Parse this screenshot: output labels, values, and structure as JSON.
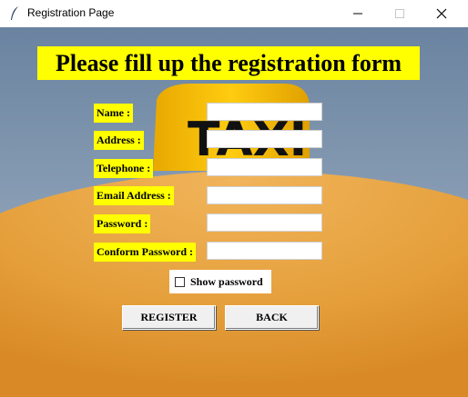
{
  "window": {
    "title": "Registration Page",
    "icon": "feather-icon",
    "controls": [
      "minimize-icon",
      "maximize-icon",
      "close-icon"
    ]
  },
  "heading": "Please fill up the registration form",
  "background": {
    "sign_text": "TAXI"
  },
  "form": {
    "fields": [
      {
        "label": "Name :",
        "value": ""
      },
      {
        "label": "Address :",
        "value": ""
      },
      {
        "label": "Telephone :",
        "value": ""
      },
      {
        "label": "Email Address :",
        "value": ""
      },
      {
        "label": "Password :",
        "value": ""
      },
      {
        "label": "Conform Password :",
        "value": ""
      }
    ],
    "show_password": {
      "label": "Show password",
      "checked": false
    }
  },
  "buttons": {
    "register": "REGISTER",
    "back": "BACK"
  },
  "colors": {
    "label_bg": "#ffff00",
    "sky": "#6f8aa6",
    "roof": "#e8a443",
    "sign": "#f5c000"
  }
}
